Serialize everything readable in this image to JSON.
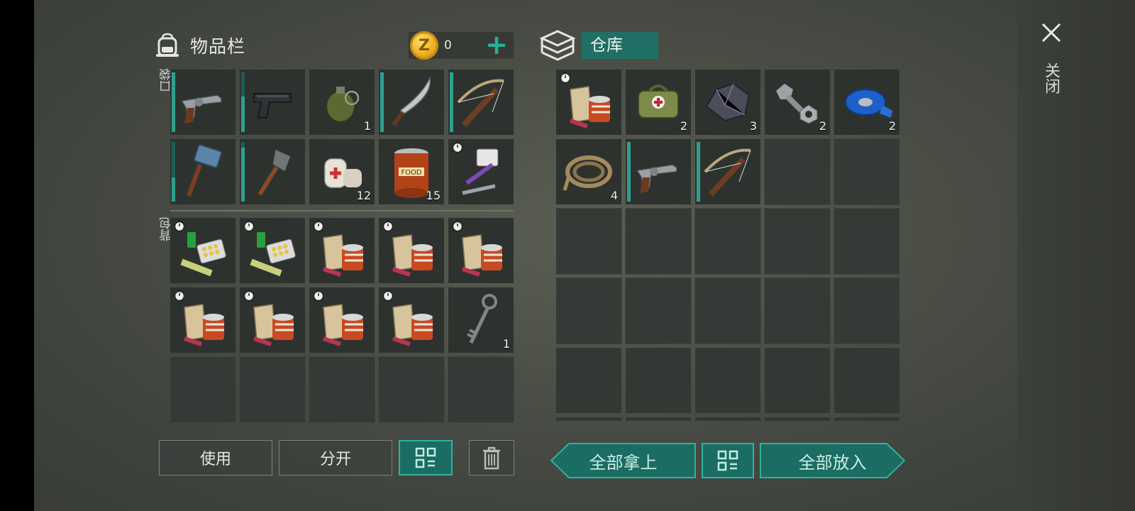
{
  "inventory": {
    "title": "物品栏",
    "coins": "0",
    "pocket_label": "口袋",
    "backpack_label": "背包",
    "pocket_slots": [
      {
        "item": "revolver-icon",
        "qty": "",
        "durability": 100
      },
      {
        "item": "pistol-icon",
        "qty": "",
        "durability": 60
      },
      {
        "item": "grenade-icon",
        "qty": "1"
      },
      {
        "item": "machete-icon",
        "qty": "",
        "durability": 100
      },
      {
        "item": "crossbow-icon",
        "qty": "",
        "durability": 100
      },
      {
        "item": "sledgehammer-icon",
        "qty": "",
        "durability": 40
      },
      {
        "item": "shovel-icon",
        "qty": "",
        "durability": 90
      },
      {
        "item": "bandage-icon",
        "qty": "12"
      },
      {
        "item": "canned-food-icon",
        "qty": "15"
      },
      {
        "item": "repair-kit-icon",
        "qty": "",
        "timer": true
      }
    ],
    "backpack_slots": [
      {
        "item": "medicine-kit-icon",
        "timer": true
      },
      {
        "item": "medicine-kit-icon",
        "timer": true
      },
      {
        "item": "food-ration-icon",
        "timer": true
      },
      {
        "item": "food-ration-icon",
        "timer": true
      },
      {
        "item": "food-ration-icon",
        "timer": true
      },
      {
        "item": "food-ration-icon",
        "timer": true
      },
      {
        "item": "food-ration-icon",
        "timer": true
      },
      {
        "item": "food-ration-icon",
        "timer": true
      },
      {
        "item": "food-ration-icon",
        "timer": true
      },
      {
        "item": "key-icon",
        "qty": "1"
      }
    ],
    "buttons": {
      "use": "使用",
      "split": "分开"
    }
  },
  "warehouse": {
    "title": "仓库",
    "slots": [
      {
        "item": "food-ration-icon",
        "timer": true
      },
      {
        "item": "first-aid-bag-icon",
        "qty": "2"
      },
      {
        "item": "ore-icon",
        "qty": "3"
      },
      {
        "item": "bolt-nut-icon",
        "qty": "2"
      },
      {
        "item": "duct-tape-icon",
        "qty": "2"
      },
      {
        "item": "rope-icon",
        "qty": "4"
      },
      {
        "item": "revolver-icon",
        "durability": 100
      },
      {
        "item": "crossbow-icon",
        "durability": 100
      }
    ],
    "buttons": {
      "take_all": "全部拿上",
      "put_all": "全部放入"
    }
  },
  "close_label": "关闭",
  "colors": {
    "accent": "#1f6f64",
    "accent_border": "#30b29d",
    "coin": "#f0c23a"
  }
}
